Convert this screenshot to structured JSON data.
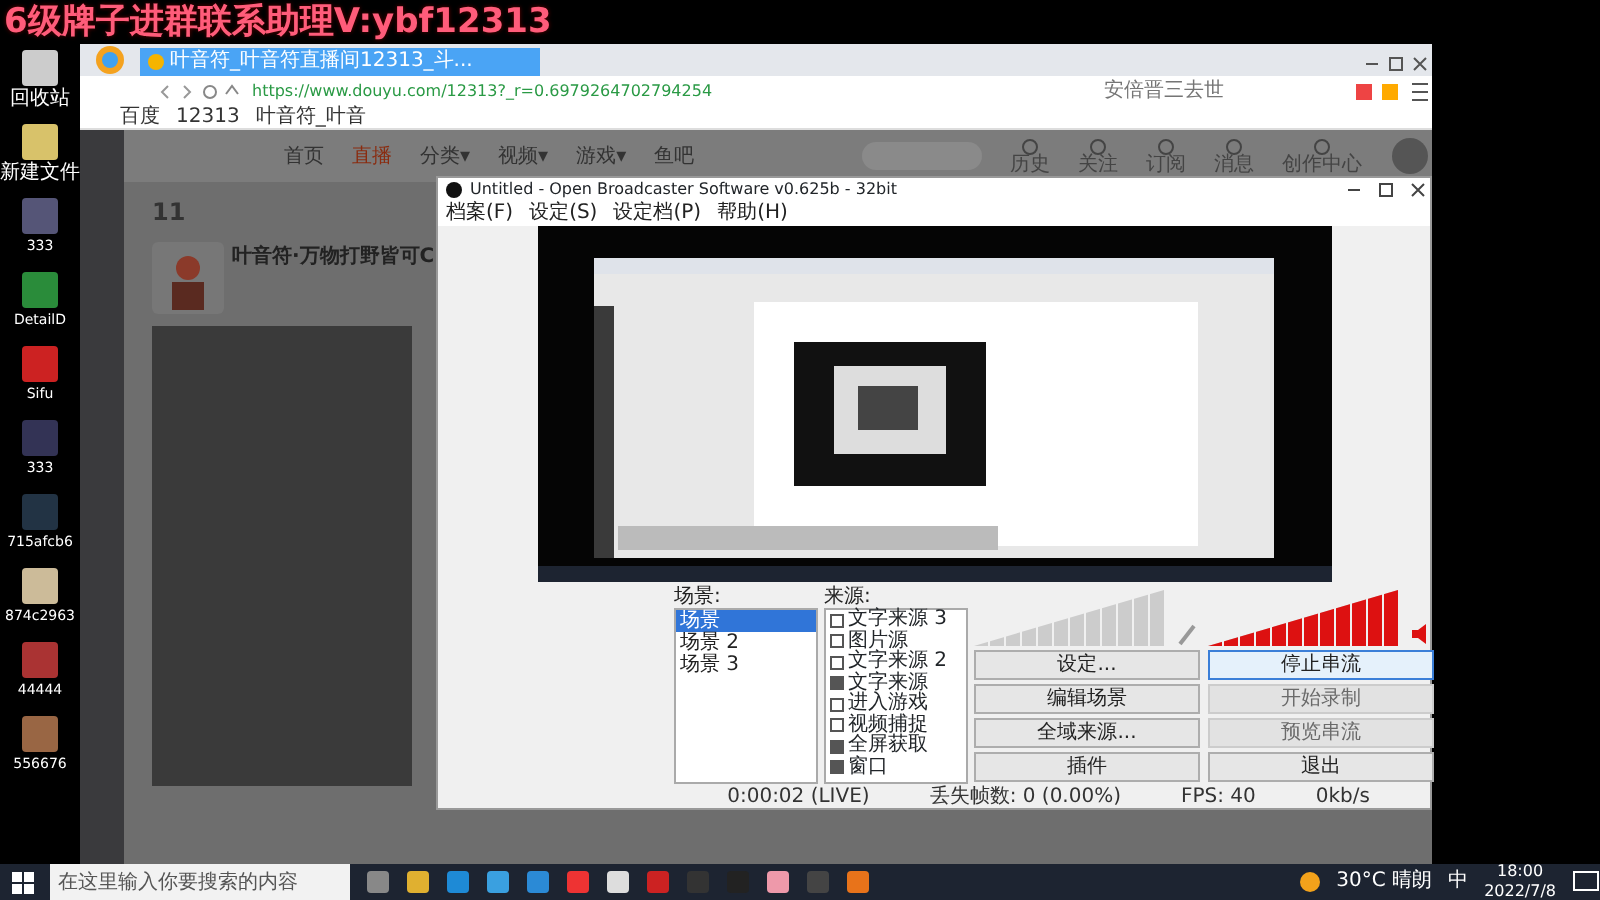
{
  "overlay_text": "6级牌子进群联系助理V:ybf12313",
  "desktop_icons": [
    {
      "label": "回收站"
    },
    {
      "label": "新建文件"
    },
    {
      "label": "333"
    },
    {
      "label": "DetailD"
    },
    {
      "label": "Sifu"
    },
    {
      "label": "333"
    },
    {
      "label": "715afcb6"
    },
    {
      "label": "874c2963"
    },
    {
      "label": "44444"
    },
    {
      "label": "556676"
    }
  ],
  "browser": {
    "tab": "叶音符_叶音符直播间12313_斗...",
    "url": "https://www.douyu.com/12313?_r=0.6979264702794254",
    "search_placeholder": "安倍晋三去世",
    "bookmarks": [
      "百度",
      "12313",
      "叶音符_叶音"
    ],
    "site_nav": [
      {
        "label": "首页",
        "selected": false
      },
      {
        "label": "直播",
        "selected": true
      },
      {
        "label": "分类▾",
        "selected": false
      },
      {
        "label": "视频▾",
        "selected": false
      },
      {
        "label": "游戏▾",
        "selected": false
      },
      {
        "label": "鱼吧",
        "selected": false
      }
    ],
    "user_tools": [
      "历史",
      "关注",
      "订阅",
      "消息",
      "创作中心"
    ],
    "stat_value": "11",
    "room_title": "叶音符·万物打野皆可C"
  },
  "obs": {
    "title": "Untitled - Open Broadcaster Software v0.625b - 32bit",
    "menu": [
      "档案(F)",
      "设定(S)",
      "设定档(P)",
      "帮助(H)"
    ],
    "scenes_label": "场景:",
    "scenes": [
      {
        "label": "场景",
        "selected": true
      },
      {
        "label": "场景 2",
        "selected": false
      },
      {
        "label": "场景 3",
        "selected": false
      }
    ],
    "sources_label": "来源:",
    "sources": [
      {
        "label": "文字来源 3",
        "checked": false
      },
      {
        "label": "图片源",
        "checked": false
      },
      {
        "label": "文字来源 2",
        "checked": false
      },
      {
        "label": "文字来源",
        "checked": true
      },
      {
        "label": "进入游戏",
        "checked": false
      },
      {
        "label": "视频捕捉",
        "checked": false
      },
      {
        "label": "全屏获取",
        "checked": true
      },
      {
        "label": "窗口",
        "checked": true
      }
    ],
    "meters": [
      {
        "kind": "mic",
        "level": 0
      },
      {
        "kind": "desktop",
        "level": 1
      }
    ],
    "buttons": [
      {
        "label": "设定...",
        "disabled": false,
        "focused": false
      },
      {
        "label": "停止串流",
        "disabled": false,
        "focused": true
      },
      {
        "label": "编辑场景",
        "disabled": false,
        "focused": false
      },
      {
        "label": "开始录制",
        "disabled": true,
        "focused": false
      },
      {
        "label": "全域来源...",
        "disabled": false,
        "focused": false
      },
      {
        "label": "预览串流",
        "disabled": true,
        "focused": false
      },
      {
        "label": "插件",
        "disabled": false,
        "focused": false
      },
      {
        "label": "退出",
        "disabled": false,
        "focused": false
      }
    ],
    "status": [
      "0:00:02 (LIVE)",
      "丢失帧数: 0 (0.00%)",
      "FPS: 40",
      "0kb/s"
    ]
  },
  "taskbar": {
    "search_placeholder": "在这里输入你要搜索的内容",
    "weather": "30°C 晴朗",
    "ime": "中",
    "time": "18:00",
    "date": "2022/7/8"
  }
}
